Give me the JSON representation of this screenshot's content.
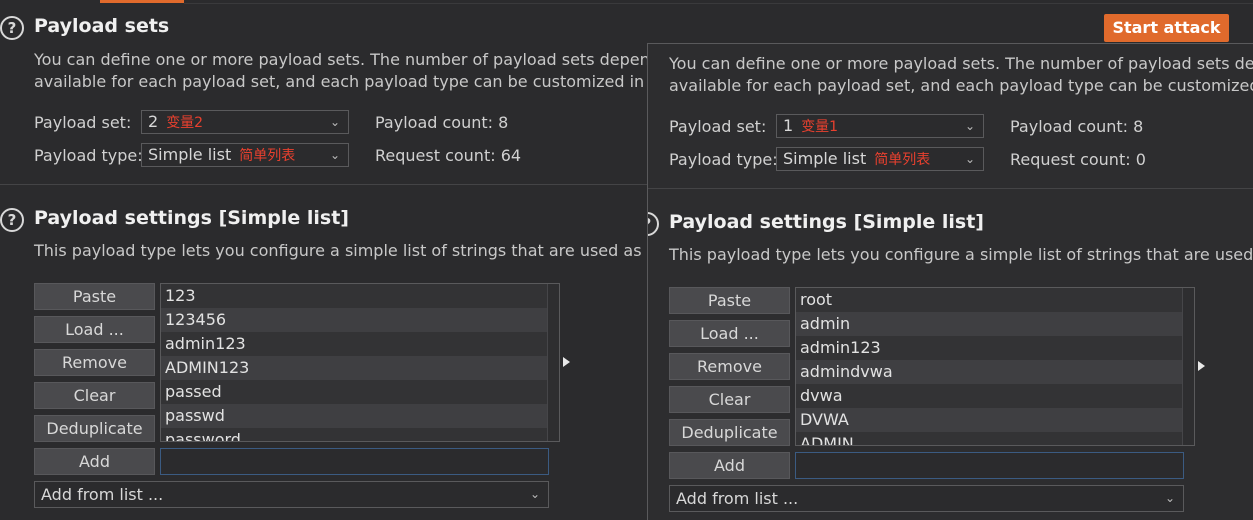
{
  "left": {
    "payload_sets": {
      "title": "Payload sets",
      "desc_line1": "You can define one or more payload sets. The number of payload sets depends o",
      "desc_line2": "available for each payload set, and each payload type can be customized in diffe",
      "payload_set_label": "Payload set:",
      "payload_set_value": "2",
      "payload_set_note": "变量2",
      "payload_type_label": "Payload type:",
      "payload_type_value": "Simple list",
      "payload_type_note": "简单列表",
      "payload_count": "Payload count: 8",
      "request_count": "Request count: 64"
    },
    "start_attack": "Start attack",
    "payload_settings": {
      "title": "Payload settings [Simple list]",
      "desc": "This payload type lets you configure a simple list of strings that are used as paylo",
      "buttons": [
        "Paste",
        "Load ...",
        "Remove",
        "Clear",
        "Deduplicate"
      ],
      "add_label": "Add",
      "add_from_list": "Add from list ...",
      "items": [
        "123",
        "123456",
        "admin123",
        "ADMIN123",
        "passed",
        "passwd",
        "password"
      ]
    }
  },
  "right": {
    "payload_sets": {
      "desc_line1": "You can define one or more payload sets. The number of payload sets depe",
      "desc_line2": "available for each payload set, and each payload type can be customized in",
      "payload_set_label": "Payload set:",
      "payload_set_value": "1",
      "payload_set_note": "变量1",
      "payload_type_label": "Payload type:",
      "payload_type_value": "Simple list",
      "payload_type_note": "简单列表",
      "payload_count": "Payload count: 8",
      "request_count": "Request count: 0"
    },
    "payload_settings": {
      "title": "Payload settings [Simple list]",
      "desc": "This payload type lets you configure a simple list of strings that are used as",
      "buttons": [
        "Paste",
        "Load ...",
        "Remove",
        "Clear",
        "Deduplicate"
      ],
      "add_label": "Add",
      "add_from_list": "Add from list ...",
      "items": [
        "root",
        "admin",
        "admin123",
        "admindvwa",
        "dvwa",
        "DVWA",
        "ADMIN"
      ]
    }
  },
  "icons": {
    "help": "help-circle-icon",
    "chevron": "chevron-down-icon",
    "arrow": "arrow-right-icon"
  },
  "colors": {
    "accent": "#e06a2c",
    "note_red": "#e8402e",
    "background": "#2b2b2d"
  }
}
